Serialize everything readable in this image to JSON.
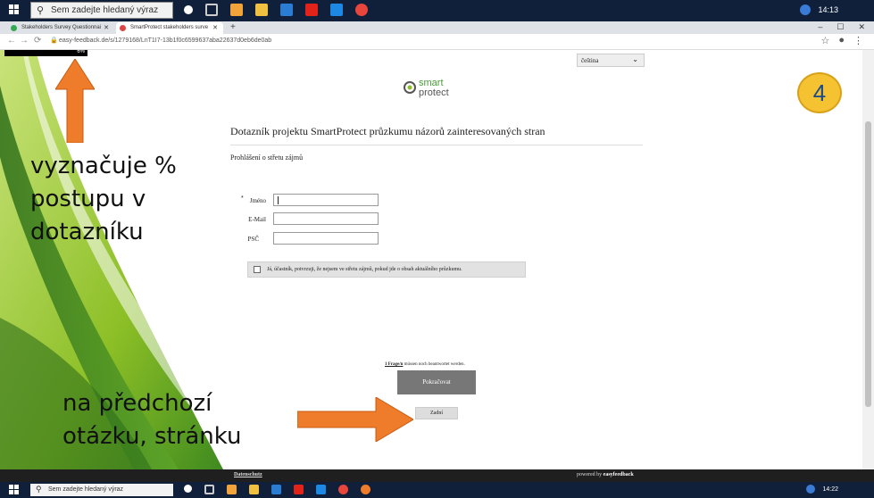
{
  "taskbar_top": {
    "search_placeholder": "Sem zadejte hledaný výraz",
    "clock": "14:13"
  },
  "browser": {
    "tabs": [
      {
        "label": "Stakeholders Survey Questionnai",
        "color": "#34a853"
      },
      {
        "label": "SmartProtect stakeholders surve",
        "color": "#d44"
      }
    ],
    "new_tab": "+",
    "url": "easy-feedback.de/s/1279168/LnT1I7-13b1f0c6599637aba22637d0eb6de0ab",
    "window_controls": [
      "–",
      "☐",
      "✕"
    ]
  },
  "page": {
    "progress": {
      "value": 0.06,
      "label": "6%"
    },
    "language_select": {
      "value": "čeština"
    },
    "logo": {
      "top": "smart",
      "bottom": "protect"
    },
    "step_badge": "4",
    "survey_title": "Dotazník projektu SmartProtect průzkumu názorů zainteresovaných stran",
    "section_title": "Prohlášení o střetu zájmů",
    "fields": [
      {
        "label": "Jméno",
        "required": true,
        "value": ""
      },
      {
        "label": "E-Mail",
        "required": false,
        "value": ""
      },
      {
        "label": "PSČ",
        "required": false,
        "value": ""
      }
    ],
    "required_mark": "*",
    "consent_text": "Já, účastník, potvrzuji, že nejsem ve střetu zájmů, pokud jde o obsah aktuálního průzkumu.",
    "notice_link": "1 Frage/n",
    "notice_rest": " müssen noch beantwortet werden.",
    "next_button": "Pokračovat",
    "back_button": "Zadní"
  },
  "annotations": {
    "left_text": [
      "vyznačuje %",
      "postupu v",
      "dotazníku"
    ],
    "bottom_text": [
      "na předchozí",
      "otázku, stránku"
    ],
    "arrow_color": "#ef7c2a"
  },
  "footer": {
    "privacy": "Datenschutz",
    "powered_prefix": "powered by ",
    "powered_brand": "easyfeedback"
  },
  "taskbar_bottom": {
    "search_placeholder": "Sem zadejte hledaný výraz",
    "clock": "14:22"
  },
  "colors": {
    "accent_green": "#8cbf26",
    "dark_green": "#2f6f1a",
    "badge_yellow": "#f5c232"
  }
}
